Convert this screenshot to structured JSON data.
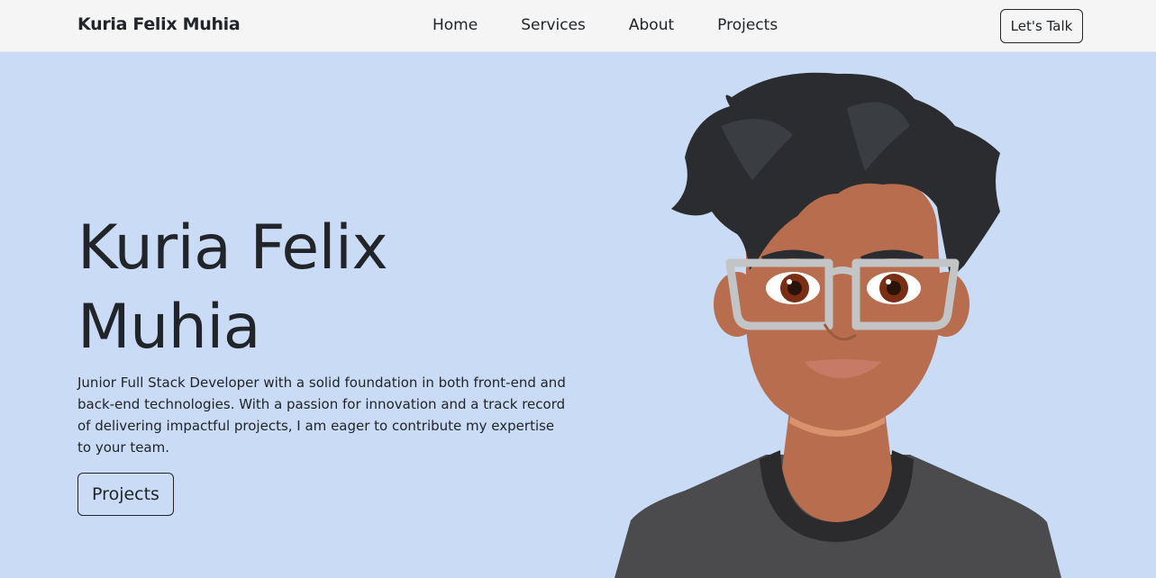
{
  "navbar": {
    "brand": "Kuria Felix Muhia",
    "links": [
      {
        "label": "Home"
      },
      {
        "label": "Services"
      },
      {
        "label": "About"
      },
      {
        "label": "Projects"
      }
    ],
    "cta_label": "Let's Talk"
  },
  "hero": {
    "title": "Kuria Felix Muhia",
    "description": "Junior Full Stack Developer with a solid foundation in both front-end and back-end technologies. With a passion for innovation and a track record of delivering impactful projects, I am eager to contribute my expertise to your team.",
    "button_label": "Projects"
  },
  "colors": {
    "navbar_bg": "#f5f5f5",
    "hero_bg": "#cadbf5",
    "text": "#212529",
    "skin": "#b86e4e",
    "hair": "#2a2c30",
    "shirt": "#4b4b4e",
    "glasses": "#c2c4c6"
  },
  "icons": {
    "avatar": "cartoon-developer-avatar"
  }
}
